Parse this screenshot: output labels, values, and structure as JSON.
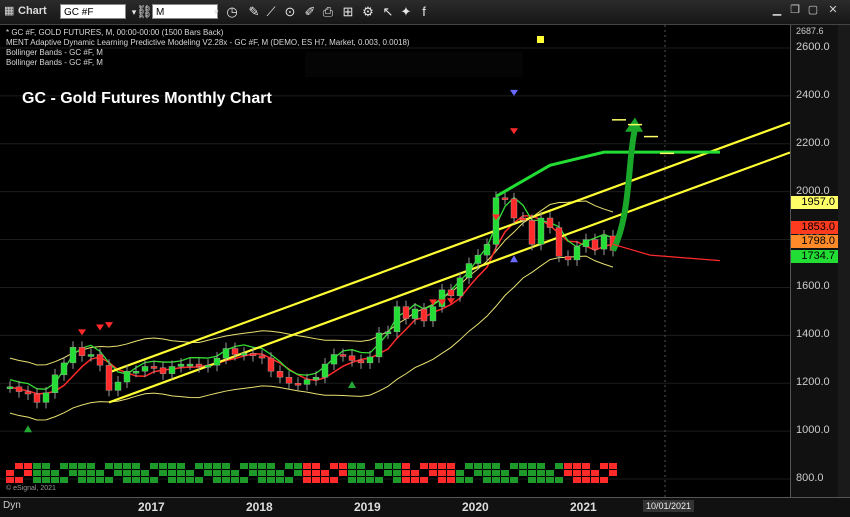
{
  "toolbar": {
    "app_label": "Chart",
    "symbol_value": "GC #F",
    "interval_value": "M",
    "icons": [
      "chart-icon",
      "dropdown-icon",
      "link-icon",
      "clock-icon",
      "pencil-icon",
      "line-icon",
      "circle-icon",
      "brush-icon",
      "camera-icon",
      "grid-icon",
      "settings-icon",
      "cursor-icon",
      "print-icon",
      "export-icon",
      "twitter-icon",
      "facebook-icon"
    ]
  },
  "studies": [
    "* GC #F, GOLD FUTURES, M, 00:00-00:00 (1500 Bars Back)",
    "MENT Adaptive Dynamic Learning Predictive Modeling V2.28x - GC #F, M (DEMO, ES H7, Market, 0.003, 0.0018)",
    "Bollinger Bands - GC #F, M",
    "Bollinger Bands - GC #F, M"
  ],
  "overlay_title": "GC - Gold Futures Monthly Chart",
  "copyright": "© eSignal, 2021",
  "bottom_left_label": "Dyn",
  "axis": {
    "y_ticks": [
      "2600.0",
      "2400.0",
      "2200.0",
      "2000.0",
      "1800.0",
      "1600.0",
      "1400.0",
      "1200.0",
      "1000.0",
      "800.0"
    ],
    "y_top_label": "2687.6",
    "x_ticks": [
      "2017",
      "2018",
      "2019",
      "2020",
      "2021"
    ],
    "x_date_tag": "10/01/2021"
  },
  "price_tags": [
    {
      "label": "1957.0",
      "color": "#ffff66",
      "text": "#000"
    },
    {
      "label": "1853.0",
      "color": "#ff3b1f",
      "text": "#000"
    },
    {
      "label": "1798.0",
      "color": "#ff8a2a",
      "text": "#000"
    },
    {
      "label": "1734.7",
      "color": "#22dd33",
      "text": "#000"
    }
  ],
  "chart_data": {
    "type": "line",
    "title": "GC - Gold Futures Monthly Chart",
    "ylim": [
      800,
      2687.6
    ],
    "y_ticks": [
      800,
      1000,
      1200,
      1400,
      1600,
      1800,
      2000,
      2200,
      2400,
      2600
    ],
    "x_ticks": [
      "2017",
      "2018",
      "2019",
      "2020",
      "2021"
    ],
    "price_close_monthly": [
      1185,
      1165,
      1155,
      1120,
      1160,
      1235,
      1285,
      1350,
      1315,
      1320,
      1275,
      1170,
      1205,
      1250,
      1250,
      1270,
      1265,
      1240,
      1270,
      1280,
      1280,
      1270,
      1275,
      1305,
      1345,
      1320,
      1325,
      1315,
      1305,
      1250,
      1225,
      1200,
      1195,
      1215,
      1225,
      1280,
      1320,
      1315,
      1295,
      1285,
      1310,
      1410,
      1415,
      1520,
      1470,
      1510,
      1460,
      1520,
      1590,
      1565,
      1640,
      1700,
      1735,
      1780,
      1975,
      1970,
      1890,
      1880,
      1780,
      1890,
      1850,
      1730,
      1715,
      1770,
      1800,
      1760,
      1815,
      1755
    ],
    "channel_lines": [
      {
        "name": "upper",
        "color": "#ffff33",
        "x": [
          "2016-12",
          "2021-10"
        ],
        "y": [
          1245,
          2045
        ]
      },
      {
        "name": "lower",
        "color": "#ffff33",
        "x": [
          "2016-12",
          "2021-10"
        ],
        "y": [
          1120,
          1920
        ]
      }
    ],
    "projection": {
      "color": "#22dd33",
      "levels": [
        2165,
        2300,
        2280,
        2230,
        2160
      ]
    },
    "price_tags": [
      1957.0,
      1853.0,
      1798.0,
      1734.7
    ],
    "date_tag": "10/01/2021"
  }
}
